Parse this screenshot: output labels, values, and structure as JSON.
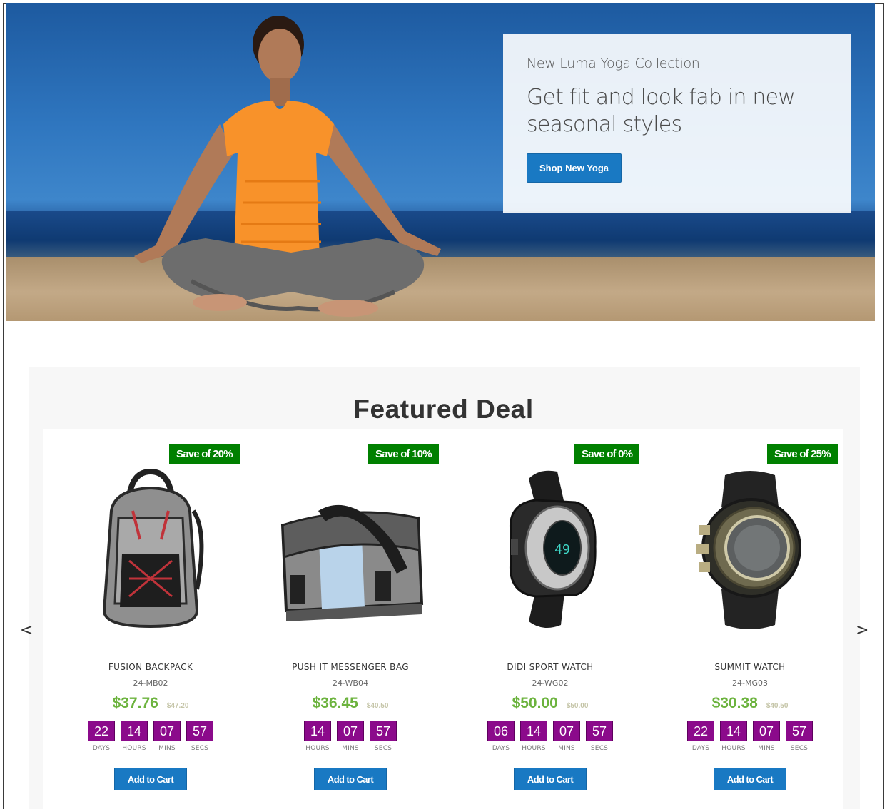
{
  "hero": {
    "subtitle": "New Luma Yoga Collection",
    "title": "Get fit and look fab in new seasonal styles",
    "button_label": "Shop New Yoga"
  },
  "featured": {
    "title": "Featured Deal",
    "prev_arrow": "<",
    "next_arrow": ">"
  },
  "products": [
    {
      "name": "FUSION BACKPACK",
      "sku": "24-MB02",
      "price": "$37.76",
      "old_price": "$47.20",
      "badge": "Save of 20%",
      "timer": [
        {
          "value": "22",
          "label": "DAYS"
        },
        {
          "value": "14",
          "label": "HOURS"
        },
        {
          "value": "07",
          "label": "MINS"
        },
        {
          "value": "57",
          "label": "SECS"
        }
      ],
      "cart_label": "Add to Cart",
      "icon": "backpack-image"
    },
    {
      "name": "PUSH IT MESSENGER BAG",
      "sku": "24-WB04",
      "price": "$36.45",
      "old_price": "$40.50",
      "badge": "Save of 10%",
      "timer": [
        {
          "value": "14",
          "label": "HOURS"
        },
        {
          "value": "07",
          "label": "MINS"
        },
        {
          "value": "57",
          "label": "SECS"
        }
      ],
      "cart_label": "Add to Cart",
      "icon": "messenger-bag-image"
    },
    {
      "name": "DIDI SPORT WATCH",
      "sku": "24-WG02",
      "price": "$50.00",
      "old_price": "$50.00",
      "badge": "Save of 0%",
      "timer": [
        {
          "value": "06",
          "label": "DAYS"
        },
        {
          "value": "14",
          "label": "HOURS"
        },
        {
          "value": "07",
          "label": "MINS"
        },
        {
          "value": "57",
          "label": "SECS"
        }
      ],
      "cart_label": "Add to Cart",
      "icon": "sport-watch-image"
    },
    {
      "name": "SUMMIT WATCH",
      "sku": "24-MG03",
      "price": "$30.38",
      "old_price": "$40.50",
      "badge": "Save of 25%",
      "timer": [
        {
          "value": "22",
          "label": "DAYS"
        },
        {
          "value": "14",
          "label": "HOURS"
        },
        {
          "value": "07",
          "label": "MINS"
        },
        {
          "value": "57",
          "label": "SECS"
        }
      ],
      "cart_label": "Add to Cart",
      "icon": "summit-watch-image"
    }
  ],
  "colors": {
    "accent_blue": "#1979c3",
    "badge_green": "#008000",
    "price_green": "#6cb33e",
    "timer_purple": "#8b0a8b"
  }
}
